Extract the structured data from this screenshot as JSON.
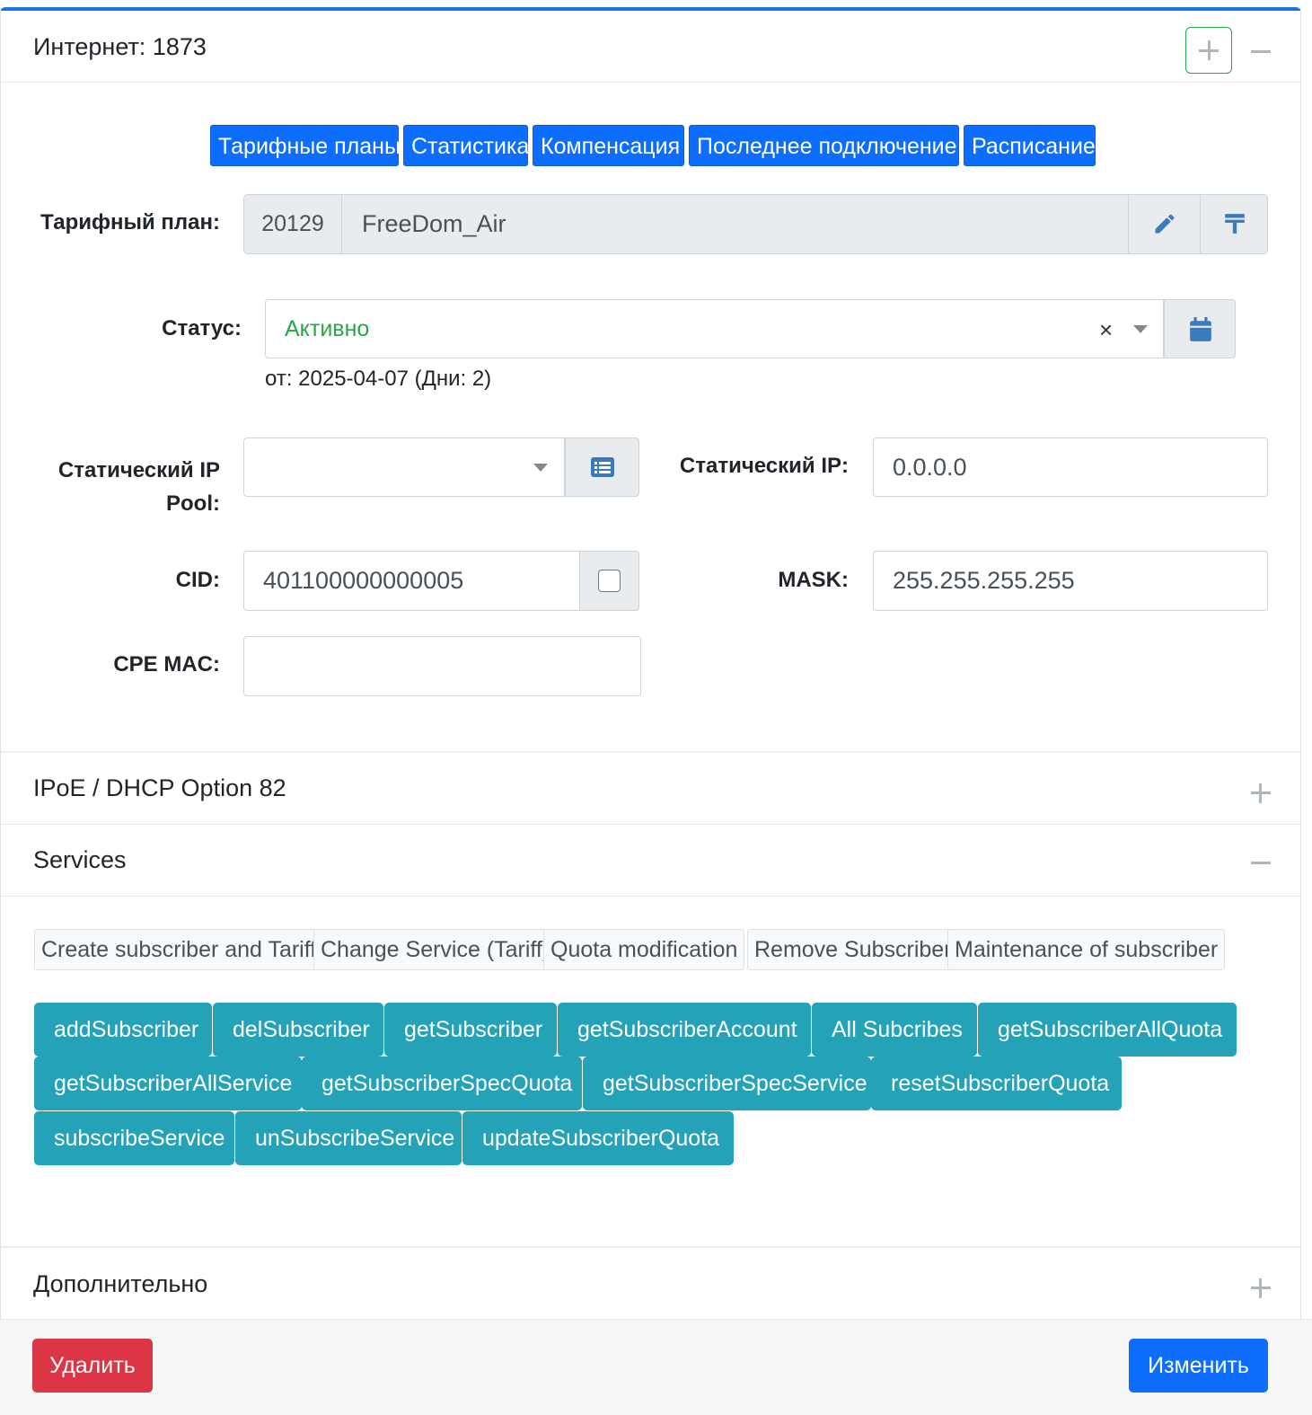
{
  "internet_panel": {
    "title": "Интернет: 1873",
    "tabs": [
      "Тарифные планы",
      "Статистика",
      "Компенсация",
      "Последнее подключение",
      "Расписание"
    ],
    "tariff": {
      "label": "Тарифный план:",
      "id": "20129",
      "name": "FreeDom_Air"
    },
    "status": {
      "label": "Статус:",
      "value": "Активно",
      "clear": "×",
      "since": "от: 2025-04-07 (Дни: 2)",
      "color": "#28a745"
    },
    "static_ip_pool": {
      "label_line1": "Статический IP",
      "label_line2": "Pool:",
      "value": ""
    },
    "static_ip": {
      "label": "Статический IP:",
      "value": "0.0.0.0"
    },
    "cid": {
      "label": "CID:",
      "value": "401100000000005"
    },
    "mask": {
      "label": "MASK:",
      "value": "255.255.255.255"
    },
    "cpe_mac": {
      "label": "CPE MAC:",
      "value": ""
    }
  },
  "ipoe_panel": {
    "title": "IPoE / DHCP Option 82"
  },
  "services_panel": {
    "title": "Services",
    "groups": [
      "Create subscriber and Tariff",
      "Change Service (Tariff)",
      "Quota modification",
      "Remove Subscriber",
      "Maintenance of subscriber"
    ],
    "apis": [
      "addSubscriber",
      "delSubscriber",
      "getSubscriber",
      "getSubscriberAccount",
      "All Subcribes",
      "getSubscriberAllQuota",
      "getSubscriberAllService",
      "getSubscriberSpecQuota",
      "getSubscriberSpecService",
      "resetSubscriberQuota",
      "subscribeService",
      "unSubscribeService",
      "updateSubscriberQuota"
    ]
  },
  "extra_panel": {
    "title": "Дополнительно"
  },
  "footer": {
    "delete_label": "Удалить",
    "edit_label": "Изменить"
  },
  "colors": {
    "primary": "#0d6efd",
    "info": "#24a2b8",
    "danger": "#dc3545",
    "success": "#28a745"
  }
}
